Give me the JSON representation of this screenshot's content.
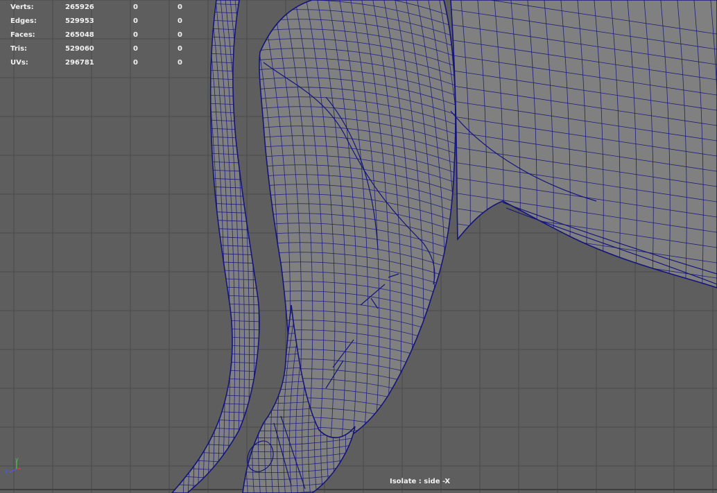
{
  "hud": {
    "rows": [
      {
        "label": "Verts:",
        "value": "265926",
        "selected": "0",
        "component": "0"
      },
      {
        "label": "Edges:",
        "value": "529953",
        "selected": "0",
        "component": "0"
      },
      {
        "label": "Faces:",
        "value": "265048",
        "selected": "0",
        "component": "0"
      },
      {
        "label": "Tris:",
        "value": "529060",
        "selected": "0",
        "component": "0"
      },
      {
        "label": "UVs:",
        "value": "296781",
        "selected": "0",
        "component": "0"
      }
    ]
  },
  "viewport": {
    "isolate_label": "Isolate : side -X",
    "background_color": "#5e5e5e",
    "grid_color": "#4a4a4a",
    "wireframe_color": "#14147a",
    "mesh_fill_color": "#808080"
  },
  "axis_gizmo": {
    "y_label": "y",
    "z_label": "z",
    "x_color": "#e04040",
    "y_color": "#40d040",
    "z_color": "#4060ff"
  }
}
